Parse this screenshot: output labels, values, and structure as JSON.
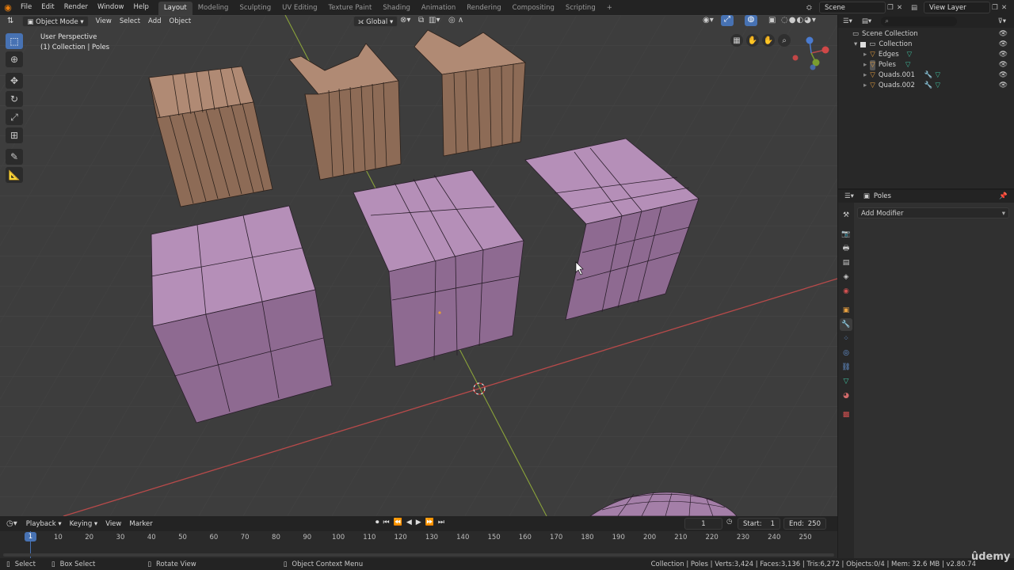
{
  "topbar": {
    "menus": [
      "File",
      "Edit",
      "Render",
      "Window",
      "Help"
    ],
    "workspaces": [
      "Layout",
      "Modeling",
      "Sculpting",
      "UV Editing",
      "Texture Paint",
      "Shading",
      "Animation",
      "Rendering",
      "Compositing",
      "Scripting"
    ],
    "active_workspace": "Layout",
    "add_tab": "+",
    "scene": "Scene",
    "view_layer": "View Layer"
  },
  "viewport_header": {
    "mode": "Object Mode",
    "menus": [
      "View",
      "Select",
      "Add",
      "Object"
    ],
    "orientation": "Global"
  },
  "viewport": {
    "perspective": "User Perspective",
    "collection_info": "(1) Collection | Poles"
  },
  "outliner": {
    "root": "Scene Collection",
    "collection": "Collection",
    "items": [
      "Edges",
      "Poles",
      "Quads.001",
      "Quads.002"
    ]
  },
  "properties": {
    "object_name": "Poles",
    "add_modifier": "Add Modifier"
  },
  "timeline": {
    "menus": [
      "Playback",
      "Keying",
      "View",
      "Marker"
    ],
    "current_frame": "1",
    "start_label": "Start:",
    "start_value": "1",
    "end_label": "End:",
    "end_value": "250",
    "ticks": [
      "1",
      "10",
      "20",
      "30",
      "40",
      "50",
      "60",
      "70",
      "80",
      "90",
      "100",
      "110",
      "120",
      "130",
      "140",
      "150",
      "160",
      "170",
      "180",
      "190",
      "200",
      "210",
      "220",
      "230",
      "240",
      "250"
    ]
  },
  "statusbar": {
    "select": "Select",
    "box_select": "Box Select",
    "rotate_view": "Rotate View",
    "context_menu": "Object Context Menu",
    "stats": "Collection | Poles | Verts:3,424 | Faces:3,136 | Tris:6,272 | Objects:0/4 | Mem: 32.6 MB | v2.80.74"
  },
  "watermark": "ûdemy",
  "colors": {
    "accent": "#4772b3",
    "mesh_purple": "#a47fa8",
    "mesh_brown": "#94735f",
    "x_axis": "#b84a4a",
    "y_axis": "#8aa23a"
  }
}
